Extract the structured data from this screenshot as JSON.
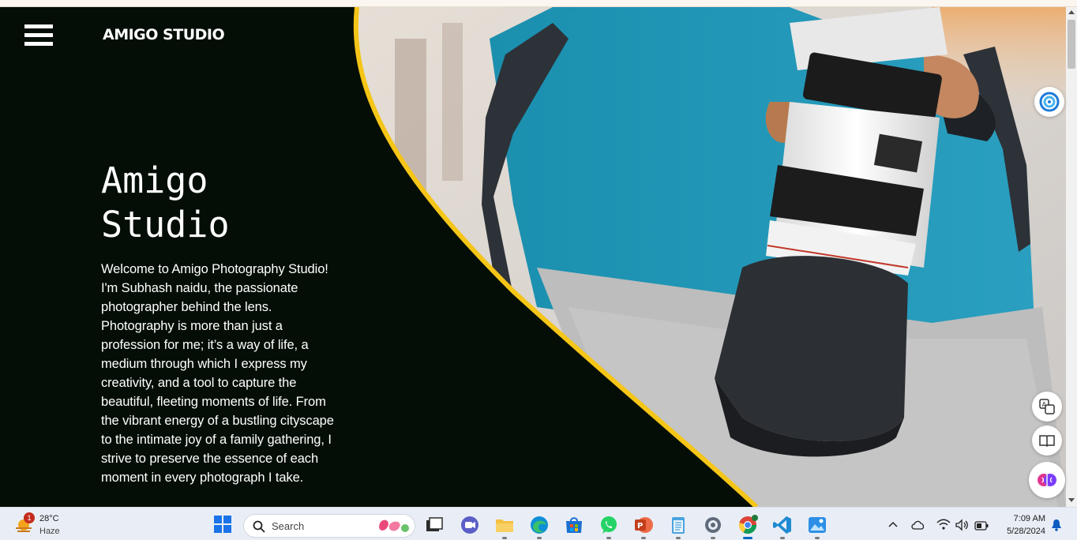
{
  "site": {
    "brand": "AMIGO STUDIO",
    "hero_title_line1": "Amigo",
    "hero_title_line2": "Studio",
    "hero_text": "Welcome to Amigo Photography Studio! I'm Subhash naidu, the passionate photographer behind the lens. Photography is more than just a profession for me; it’s a way of life, a medium through which I express my creativity, and a tool to capture the beautiful, fleeting moments of life. From the vibrant energy of a bustling cityscape to the intimate joy of a family gathering, I strive to preserve the essence of each moment in every photograph I take.",
    "colors": {
      "background": "#040e06",
      "accent": "#f5c518",
      "text": "#ffffff"
    }
  },
  "side_buttons": [
    {
      "name": "copilot-icon"
    },
    {
      "name": "translate-icon"
    },
    {
      "name": "reader-icon"
    },
    {
      "name": "brain-icon"
    }
  ],
  "taskbar": {
    "weather": {
      "temp": "28°C",
      "condition": "Haze",
      "badge": "1"
    },
    "search_placeholder": "Search",
    "apps": [
      "windows-start-icon",
      "file-explorer-icon",
      "teams-icon",
      "folder-icon",
      "edge-icon",
      "store-icon",
      "whatsapp-icon",
      "powerpoint-icon",
      "notepad-icon",
      "settings-icon",
      "chrome-icon",
      "vscode-icon",
      "photos-icon"
    ],
    "time": "7:09 AM",
    "date": "5/28/2024"
  }
}
